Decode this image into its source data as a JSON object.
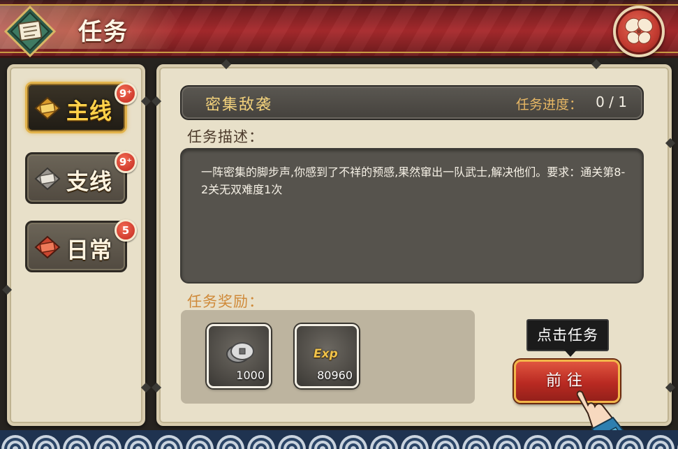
{
  "header": {
    "title": "任务",
    "colors": {
      "banner": "#a82a2d",
      "gold": "#c99b43"
    }
  },
  "tabs": [
    {
      "label": "主线",
      "badge": "9⁺",
      "icon": "scroll-gold-icon",
      "active": true
    },
    {
      "label": "支线",
      "badge": "9⁺",
      "icon": "scroll-gray-icon",
      "active": false
    },
    {
      "label": "日常",
      "badge": "5",
      "icon": "scroll-red-icon",
      "active": false
    }
  ],
  "quest": {
    "name": "密集敌袭",
    "progress_label": "任务进度：",
    "progress_value": "0 / 1",
    "description_label": "任务描述：",
    "description": "一阵密集的脚步声,你感到了不祥的预感,果然窜出一队武士,解决他们。要求：通关第8-2关无双难度1次",
    "reward_label": "任务奖励：",
    "rewards": [
      {
        "icon": "coin-icon",
        "count": "1000"
      },
      {
        "icon": "exp-icon",
        "text": "Exp",
        "count": "80960"
      }
    ]
  },
  "tooltip": "点击任务",
  "go_button": "前往",
  "colors": {
    "accent": "#f2b64a",
    "panel": "#e8e0c9",
    "dark_box": "#56534d",
    "badge": "#c3281f"
  }
}
